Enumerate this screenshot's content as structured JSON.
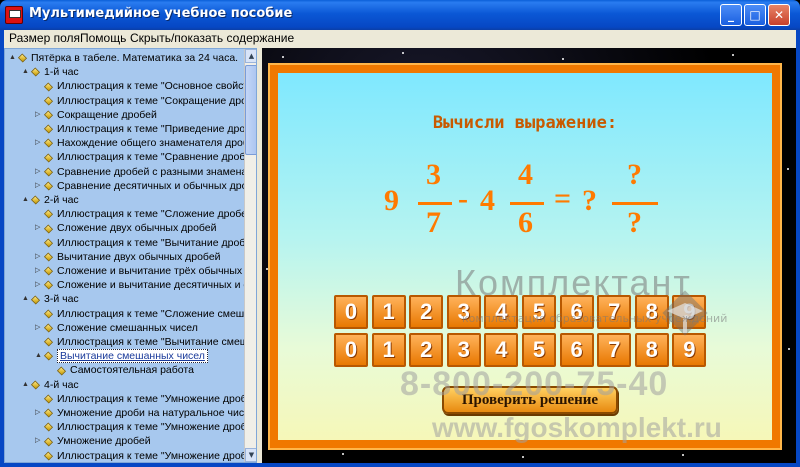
{
  "window": {
    "title": "Мультимедийное учебное пособие",
    "minimize": "_",
    "maximize": "□",
    "close": "✕"
  },
  "menu": [
    "Размер поля",
    "Помощь",
    "Скрыть/показать содержание"
  ],
  "tree": [
    {
      "level": 0,
      "exp": "▲",
      "label": "Пятёрка в табеле. Математика за 24 часа."
    },
    {
      "level": 1,
      "exp": "▲",
      "label": "1-й час"
    },
    {
      "level": 2,
      "exp": "",
      "label": "Иллюстрация к теме \"Основное свойство"
    },
    {
      "level": 2,
      "exp": "",
      "label": "Иллюстрация к теме \"Сокращение дробей\""
    },
    {
      "level": 2,
      "exp": "▷",
      "label": "Сокращение дробей"
    },
    {
      "level": 2,
      "exp": "",
      "label": "Иллюстрация к теме \"Приведение дробей"
    },
    {
      "level": 2,
      "exp": "▷",
      "label": "Нахождение общего знаменателя дробей"
    },
    {
      "level": 2,
      "exp": "",
      "label": "Иллюстрация к теме \"Сравнение дробей"
    },
    {
      "level": 2,
      "exp": "▷",
      "label": "Сравнение дробей с разными знаменателями"
    },
    {
      "level": 2,
      "exp": "▷",
      "label": "Сравнение десятичных и обычных дробей"
    },
    {
      "level": 1,
      "exp": "▲",
      "label": "2-й час"
    },
    {
      "level": 2,
      "exp": "",
      "label": "Иллюстрация к теме \"Сложение дробей"
    },
    {
      "level": 2,
      "exp": "▷",
      "label": "Сложение двух обычных дробей"
    },
    {
      "level": 2,
      "exp": "",
      "label": "Иллюстрация к теме \"Вычитание дробей"
    },
    {
      "level": 2,
      "exp": "▷",
      "label": "Вычитание двух обычных дробей"
    },
    {
      "level": 2,
      "exp": "▷",
      "label": "Сложение и вычитание трёх обычных дробей"
    },
    {
      "level": 2,
      "exp": "▷",
      "label": "Сложение и вычитание десятичных и обычных"
    },
    {
      "level": 1,
      "exp": "▲",
      "label": "3-й час"
    },
    {
      "level": 2,
      "exp": "",
      "label": "Иллюстрация к теме \"Сложение смешанных"
    },
    {
      "level": 2,
      "exp": "▷",
      "label": "Сложение смешанных чисел"
    },
    {
      "level": 2,
      "exp": "",
      "label": "Иллюстрация к теме \"Вычитание смешанных"
    },
    {
      "level": 2,
      "exp": "▲",
      "label": "Вычитание смешанных чисел",
      "selected": true
    },
    {
      "level": 3,
      "exp": "",
      "label": "Самостоятельная работа"
    },
    {
      "level": 1,
      "exp": "▲",
      "label": "4-й час"
    },
    {
      "level": 2,
      "exp": "",
      "label": "Иллюстрация к теме \"Умножение дробей"
    },
    {
      "level": 2,
      "exp": "▷",
      "label": "Умножение дроби на натуральное число"
    },
    {
      "level": 2,
      "exp": "",
      "label": "Иллюстрация к теме \"Умножение дробей"
    },
    {
      "level": 2,
      "exp": "▷",
      "label": "Умножение дробей"
    },
    {
      "level": 2,
      "exp": "",
      "label": "Иллюстрация к теме \"Умножение дробей"
    }
  ],
  "scroll": {
    "up": "▲",
    "down": "▼"
  },
  "task": {
    "title": "Вычисли выражение:",
    "whole1": "9",
    "num1": "3",
    "den1": "7",
    "minus": "-",
    "whole2": "4",
    "num2": "4",
    "den2": "6",
    "equals": "=",
    "answer_whole": "?",
    "answer_num": "?",
    "answer_den": "?"
  },
  "digits_row1": [
    "0",
    "1",
    "2",
    "3",
    "4",
    "5",
    "6",
    "7",
    "8",
    "9"
  ],
  "digits_row2": [
    "0",
    "1",
    "2",
    "3",
    "4",
    "5",
    "6",
    "7",
    "8",
    "9"
  ],
  "check_button": "Проверить решение",
  "watermark": {
    "name": "Комплектант",
    "subtitle": "комплектация образовательных учреждений",
    "phone": "8-800-200-75-40",
    "url": "www.fgoskomplekt.ru"
  }
}
